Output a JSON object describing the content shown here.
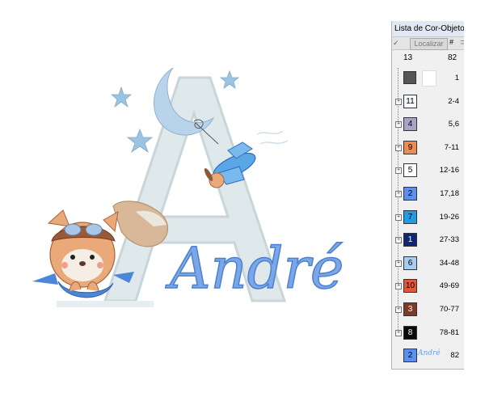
{
  "panel": {
    "title": "Lista de Cor-Objeto",
    "localizar_label": "Localizar",
    "hash_label": "#",
    "check_glyph": "✓",
    "colors_count": "13",
    "objects_count": "82",
    "rows": [
      {
        "kind": "thumb",
        "range": "1"
      },
      {
        "kind": "color",
        "code": "11",
        "color": "#f4f8ff",
        "text_color": "#000000",
        "range": "2-4"
      },
      {
        "kind": "color",
        "code": "4",
        "color": "#a9a3c8",
        "text_color": "#000000",
        "range": "5,6"
      },
      {
        "kind": "color",
        "code": "9",
        "color": "#f08a4f",
        "text_color": "#000000",
        "range": "7-11"
      },
      {
        "kind": "color",
        "code": "5",
        "color": "#ffffff",
        "text_color": "#000000",
        "range": "12-16"
      },
      {
        "kind": "color",
        "code": "2",
        "color": "#5d8ff0",
        "text_color": "#000000",
        "range": "17,18"
      },
      {
        "kind": "color",
        "code": "7",
        "color": "#1f9be8",
        "text_color": "#000000",
        "range": "19-26"
      },
      {
        "kind": "color",
        "code": "1",
        "color": "#0f2773",
        "text_color": "#ffffff",
        "range": "27-33"
      },
      {
        "kind": "color",
        "code": "6",
        "color": "#a8cdf0",
        "text_color": "#000000",
        "range": "34-48"
      },
      {
        "kind": "color",
        "code": "10",
        "color": "#e0573a",
        "text_color": "#000000",
        "range": "49-69"
      },
      {
        "kind": "color",
        "code": "3",
        "color": "#803a24",
        "text_color": "#ffffff",
        "range": "70-77"
      },
      {
        "kind": "color",
        "code": "8",
        "color": "#0a0a0a",
        "text_color": "#ffffff",
        "range": "78-81"
      },
      {
        "kind": "color-text",
        "code": "2",
        "color": "#5d8ff0",
        "text_color": "#000000",
        "mini_text": "André",
        "range": "82"
      }
    ]
  },
  "design": {
    "name_text": "André",
    "letter": "A",
    "colors": {
      "letter_fill": "#dfe8ea",
      "letter_stroke": "#c9d6d9",
      "moon": "#b9d3ea",
      "star": "#9cc3e0",
      "name": "#7aa7e8",
      "name_stroke": "#4e7fd0",
      "fox": "#e9a978",
      "plane": "#5aa6e6"
    }
  }
}
